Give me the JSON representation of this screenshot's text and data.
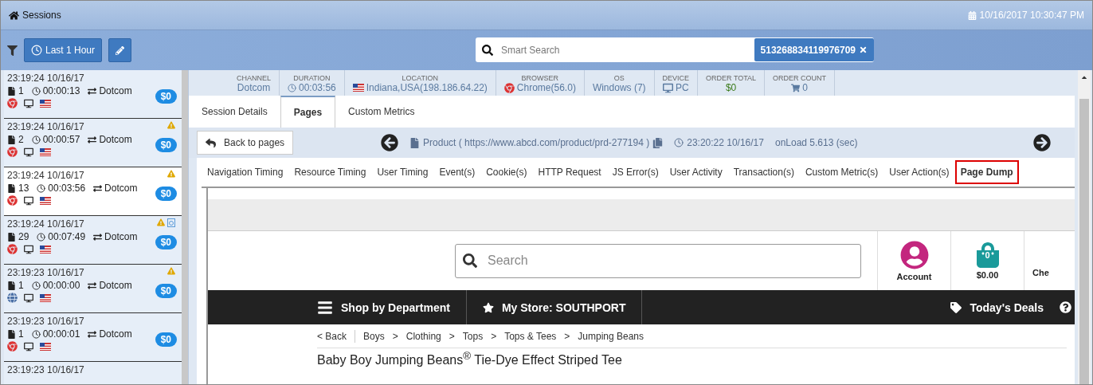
{
  "title_bar": {
    "title": "Sessions",
    "datetime": "10/16/2017 10:30:47 PM"
  },
  "toolbar": {
    "time_filter": "Last 1 Hour",
    "search": {
      "placeholder": "Smart Search",
      "token": "513268834119976709"
    }
  },
  "sessions": [
    {
      "time": "23:19:24 10/16/17",
      "pages": "1",
      "duration": "00:00:13",
      "channel": "Dotcom",
      "amount": "$0",
      "warning": false,
      "flagged": false,
      "kind": "chrome",
      "selected": false
    },
    {
      "time": "23:19:24 10/16/17",
      "pages": "2",
      "duration": "00:00:57",
      "channel": "Dotcom",
      "amount": "$0",
      "warning": true,
      "flagged": false,
      "kind": "chrome",
      "selected": false
    },
    {
      "time": "23:19:24 10/16/17",
      "pages": "13",
      "duration": "00:03:56",
      "channel": "Dotcom",
      "amount": "$0",
      "warning": true,
      "flagged": false,
      "kind": "chrome",
      "selected": true
    },
    {
      "time": "23:19:24 10/16/17",
      "pages": "29",
      "duration": "00:07:49",
      "channel": "Dotcom",
      "amount": "$0",
      "warning": true,
      "flagged": true,
      "kind": "chrome",
      "selected": false
    },
    {
      "time": "23:19:23 10/16/17",
      "pages": "1",
      "duration": "00:00:00",
      "channel": "Dotcom",
      "amount": "$0",
      "warning": true,
      "flagged": false,
      "kind": "other",
      "selected": false
    },
    {
      "time": "23:19:23 10/16/17",
      "pages": "1",
      "duration": "00:00:01",
      "channel": "Dotcom",
      "amount": "$0",
      "warning": false,
      "flagged": false,
      "kind": "chrome",
      "selected": false
    },
    {
      "time": "23:19:23 10/16/17",
      "warning": false,
      "flagged": false,
      "selected": false
    }
  ],
  "summary": [
    {
      "label": "CHANNEL",
      "value": "Dotcom",
      "kind": "plain"
    },
    {
      "label": "DURATION",
      "value": "00:03:56",
      "kind": "clock"
    },
    {
      "label": "LOCATION",
      "value": "Indiana,USA(198.186.64.22)",
      "kind": "flag"
    },
    {
      "label": "BROWSER",
      "value": "Chrome(56.0)",
      "kind": "chrome"
    },
    {
      "label": "OS",
      "value": "Windows (7)",
      "kind": "plain"
    },
    {
      "label": "DEVICE",
      "value": "PC",
      "kind": "monitor"
    },
    {
      "label": "ORDER TOTAL",
      "value": "$0",
      "kind": "money"
    },
    {
      "label": "ORDER COUNT",
      "value": "0",
      "kind": "cart"
    }
  ],
  "tabs": [
    {
      "label": "Session Details",
      "selected": false
    },
    {
      "label": "Pages",
      "selected": true
    },
    {
      "label": "Custom Metrics",
      "selected": false
    }
  ],
  "page_nav": {
    "back": "Back to pages",
    "page": "Product ( https://www.abcd.com/product/prd-277194 )",
    "time": "23:20:22 10/16/17",
    "onload": "onLoad 5.613 (sec)"
  },
  "sub_tabs": [
    {
      "label": "Navigation Timing",
      "selected": false
    },
    {
      "label": "Resource Timing",
      "selected": false
    },
    {
      "label": "User Timing",
      "selected": false
    },
    {
      "label": "Event(s)",
      "selected": false
    },
    {
      "label": "Cookie(s)",
      "selected": false
    },
    {
      "label": "HTTP Request",
      "selected": false
    },
    {
      "label": "JS Error(s)",
      "selected": false
    },
    {
      "label": "User Activity",
      "selected": false
    },
    {
      "label": "Transaction(s)",
      "selected": false
    },
    {
      "label": "Custom Metric(s)",
      "selected": false
    },
    {
      "label": "User Action(s)",
      "selected": false
    },
    {
      "label": "Page Dump",
      "selected": true
    }
  ],
  "page_dump": {
    "search_placeholder": "Search",
    "account": "Account",
    "cart_count": "0",
    "cart_total": "$0.00",
    "checkout": "Che",
    "nav": [
      "Shop by Department",
      "My Store: SOUTHPORT",
      "Today's Deals"
    ],
    "breadcrumbs": [
      "< Back",
      "Boys",
      "Clothing",
      "Tops",
      "Tops & Tees",
      "Jumping Beans"
    ],
    "breadcrumb_separator": ">",
    "product_title": "Baby Boy Jumping Beans$^{®}$ Tie-Dye Effect Striped Tee"
  }
}
